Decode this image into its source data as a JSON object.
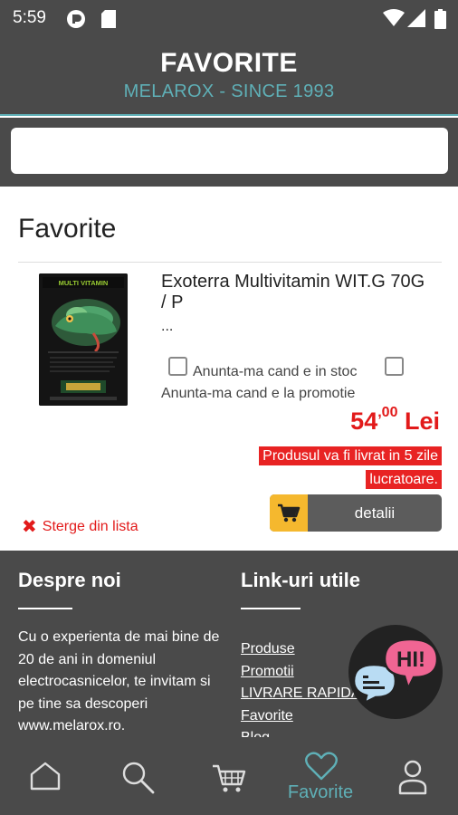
{
  "status_bar": {
    "time": "5:59"
  },
  "header": {
    "title": "FAVORITE",
    "subtitle": "MELAROX - SINCE 1993"
  },
  "search": {
    "value": "",
    "placeholder": ""
  },
  "page_title": "Favorite",
  "product": {
    "name": "Exoterra Multivitamin WIT.G 70G / P",
    "ellipsis": "...",
    "image_text": "MULTI VITAMIN",
    "notify_stock_label": "Anunta-ma cand e in stoc",
    "notify_promo_label": "Anunta-ma cand e la promotie",
    "price_int": "54",
    "price_dec": "00",
    "currency": "Lei",
    "delivery_line1": "Produsul va fi livrat in 5 zile",
    "delivery_line2": "lucratoare.",
    "details_label": "detalii",
    "remove_label": "Sterge din lista"
  },
  "footer": {
    "about_title": "Despre noi",
    "about_text": "Cu o experienta de mai bine de 20 de ani in domeniul electrocasnicelor, te invitam si pe tine sa descoperi www.melarox.ro.",
    "links_title": "Link-uri utile",
    "links": [
      "Produse",
      "Promotii",
      "LIVRARE RAPIDA",
      "Favorite",
      "Blog"
    ]
  },
  "chat": {
    "label": "HI!"
  },
  "bottom_nav": {
    "items": [
      {
        "icon": "home-icon"
      },
      {
        "icon": "search-icon"
      },
      {
        "icon": "cart-icon"
      },
      {
        "icon": "heart-icon",
        "label": "Favorite",
        "active": true
      },
      {
        "icon": "user-icon"
      }
    ]
  },
  "colors": {
    "header_bg": "#4a4a4a",
    "accent_teal": "#5fb0b7",
    "price_red": "#e21a1a",
    "cart_yellow": "#f5b82e",
    "chat_pink": "#f06593",
    "chat_blue": "#b9dcf3"
  }
}
